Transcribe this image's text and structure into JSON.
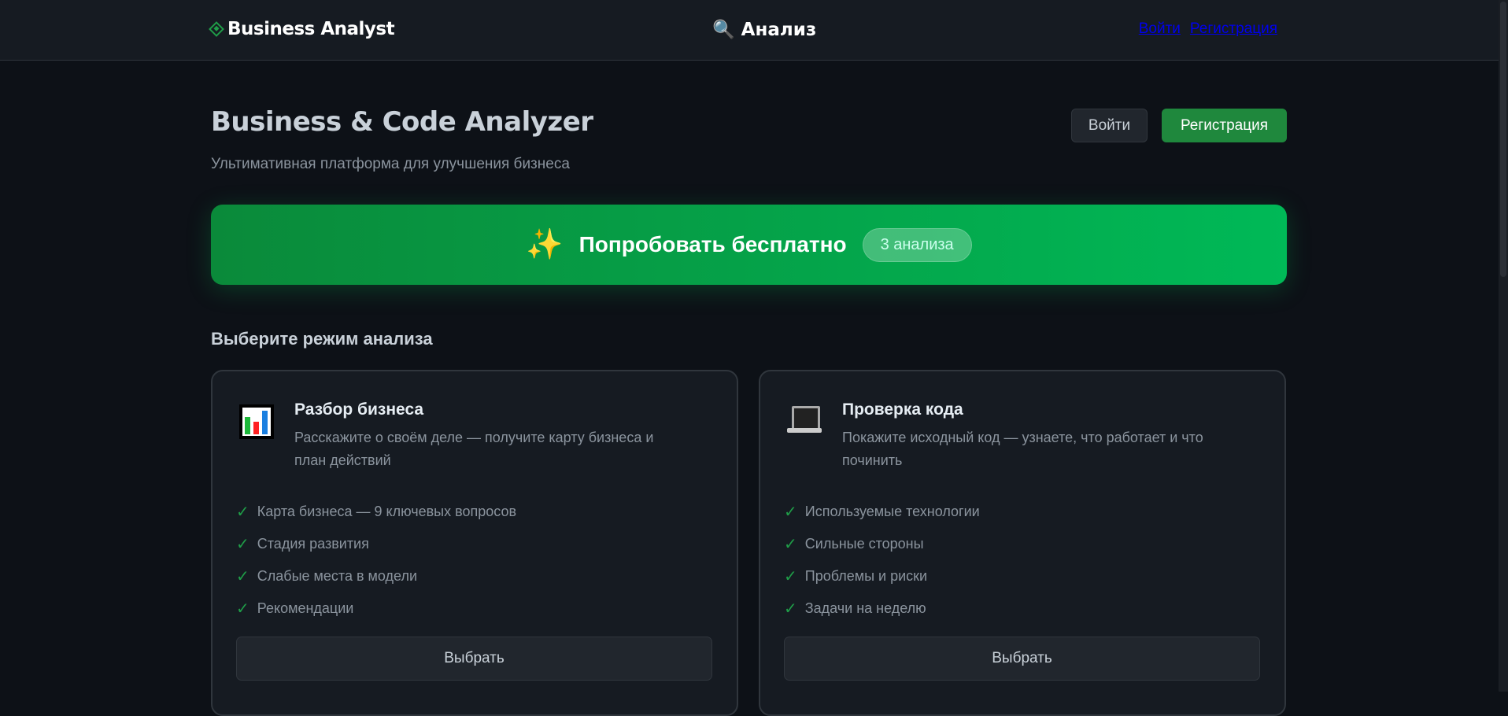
{
  "header": {
    "logo": "Business Analyst",
    "center": "🔍 Анализ",
    "login_link": "Войти",
    "register_link": "Регистрация"
  },
  "hero": {
    "title": "Business & Code Analyzer",
    "subtitle": "Ультимативная платформа для улучшения бизнеса",
    "login_button": "Войти",
    "register_button": "Регистрация"
  },
  "banner": {
    "icon": "✨",
    "label": "Попробовать бесплатно",
    "badge": "3 анализа"
  },
  "modes": {
    "heading": "Выберите режим анализа",
    "cards": [
      {
        "icon": "bar-chart",
        "title": "Разбор бизнеса",
        "description": "Расскажите о своём деле — получите карту бизнеса и план действий",
        "features": [
          "Карта бизнеса — 9 ключевых вопросов",
          "Стадия развития",
          "Слабые места в модели",
          "Рекомендации"
        ],
        "button": "Выбрать"
      },
      {
        "icon": "laptop",
        "title": "Проверка кода",
        "description": "Покажите исходный код — узнаете, что работает и что починить",
        "features": [
          "Используемые технологии",
          "Сильные стороны",
          "Проблемы и риски",
          "Задачи на неделю"
        ],
        "button": "Выбрать"
      }
    ]
  },
  "check_mark": "✓",
  "colors": {
    "accent": "#1f883d",
    "background": "#0d1117",
    "card": "#161b22"
  }
}
